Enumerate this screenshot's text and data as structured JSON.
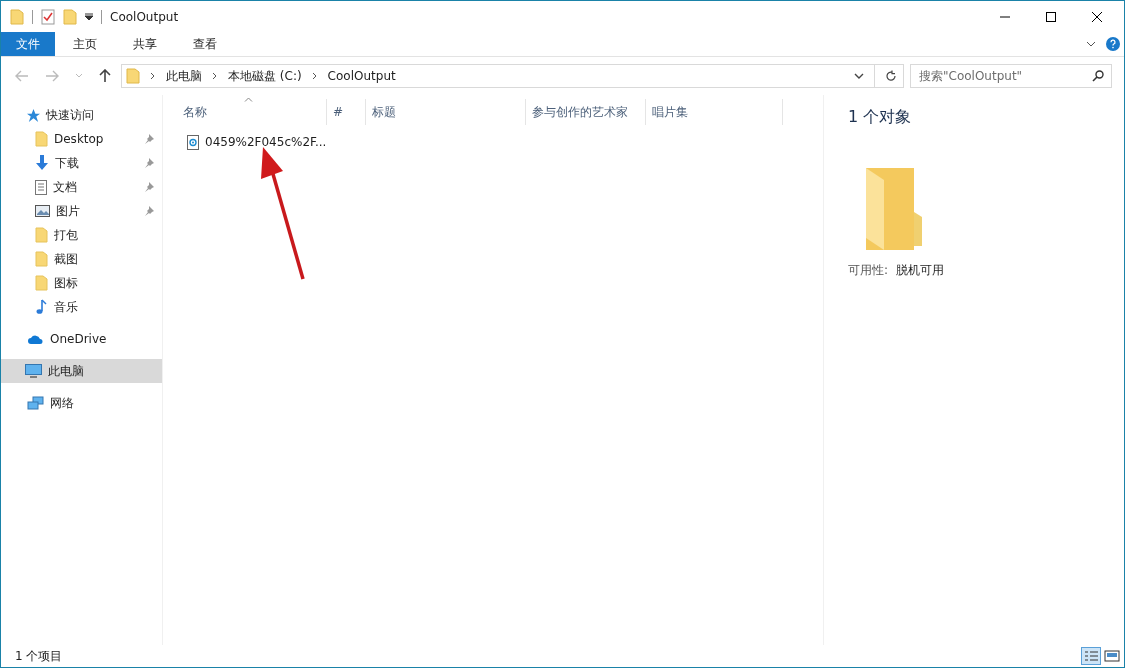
{
  "window": {
    "title": "CoolOutput"
  },
  "ribbon_tabs": [
    {
      "label": "文件",
      "selected": true
    },
    {
      "label": "主页",
      "selected": false
    },
    {
      "label": "共享",
      "selected": false
    },
    {
      "label": "查看",
      "selected": false
    }
  ],
  "address": {
    "segments": [
      "此电脑",
      "本地磁盘 (C:)",
      "CoolOutput"
    ]
  },
  "search": {
    "placeholder": "搜索\"CoolOutput\""
  },
  "sidebar": {
    "items": [
      {
        "kind": "star",
        "label": "快速访问",
        "pinned": false,
        "selected": false
      },
      {
        "kind": "folder",
        "label": "Desktop",
        "pinned": true,
        "selected": false
      },
      {
        "kind": "download",
        "label": "下载",
        "pinned": true,
        "selected": false
      },
      {
        "kind": "document",
        "label": "文档",
        "pinned": true,
        "selected": false
      },
      {
        "kind": "picture",
        "label": "图片",
        "pinned": true,
        "selected": false
      },
      {
        "kind": "folder",
        "label": "打包",
        "pinned": false,
        "selected": false
      },
      {
        "kind": "folder",
        "label": "截图",
        "pinned": false,
        "selected": false
      },
      {
        "kind": "folder",
        "label": "图标",
        "pinned": false,
        "selected": false
      },
      {
        "kind": "music",
        "label": "音乐",
        "pinned": false,
        "selected": false
      },
      {
        "kind": "cloud",
        "label": "OneDrive",
        "pinned": false,
        "selected": false
      },
      {
        "kind": "pc",
        "label": "此电脑",
        "pinned": false,
        "selected": true
      },
      {
        "kind": "network",
        "label": "网络",
        "pinned": false,
        "selected": false
      }
    ]
  },
  "table": {
    "columns": [
      "名称",
      "#",
      "标题",
      "参与创作的艺术家",
      "唱片集"
    ],
    "rows": [
      {
        "name": "0459%2F045c%2F..."
      }
    ]
  },
  "details": {
    "title": "1 个对象",
    "property_label": "可用性:",
    "property_value": "脱机可用"
  },
  "status_bar": {
    "text": "1 个项目"
  }
}
